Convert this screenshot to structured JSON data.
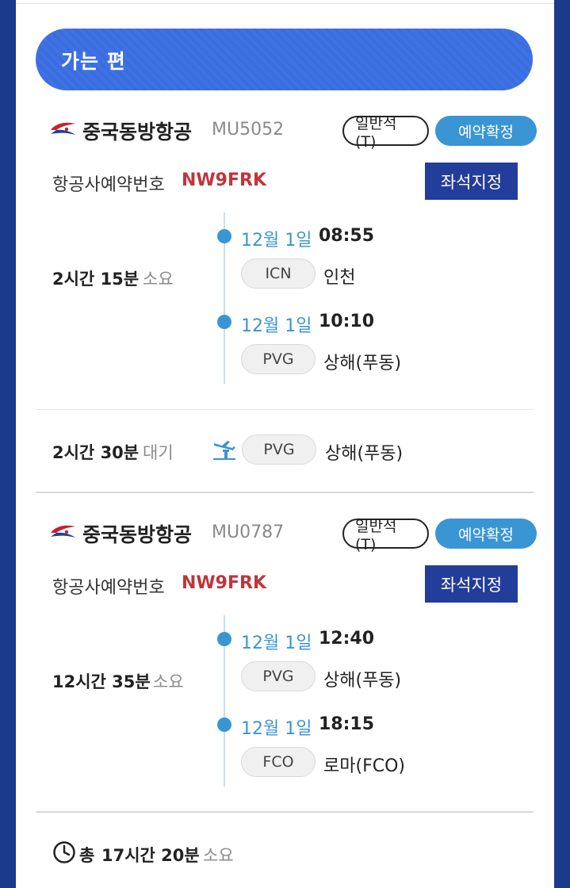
{
  "header": {
    "title": "가는 편"
  },
  "segments": [
    {
      "airline": "중국동방항공",
      "flight_no": "MU5052",
      "cabin_class": "일반석(T)",
      "status": "예약확정",
      "pnr_label": "항공사예약번호",
      "pnr_code": "NW9FRK",
      "seat_button": "좌석지정",
      "duration_value": "2시간 15분",
      "duration_suffix": "소요",
      "depart": {
        "date": "12월 1일",
        "time": "08:55",
        "code": "ICN",
        "city": "인천"
      },
      "arrive": {
        "date": "12월 1일",
        "time": "10:10",
        "code": "PVG",
        "city": "상해(푸동)"
      }
    },
    {
      "airline": "중국동방항공",
      "flight_no": "MU0787",
      "cabin_class": "일반석(T)",
      "status": "예약확정",
      "pnr_label": "항공사예약번호",
      "pnr_code": "NW9FRK",
      "seat_button": "좌석지정",
      "duration_value": "12시간 35분",
      "duration_suffix": "소요",
      "depart": {
        "date": "12월 1일",
        "time": "12:40",
        "code": "PVG",
        "city": "상해(푸동)"
      },
      "arrive": {
        "date": "12월 1일",
        "time": "18:15",
        "code": "FCO",
        "city": "로마(FCO)"
      }
    }
  ],
  "layover": {
    "duration_value": "2시간 30분",
    "duration_suffix": "대기",
    "icon": "transfer-icon",
    "code": "PVG",
    "city": "상해(푸동)"
  },
  "total": {
    "icon": "clock-icon",
    "prefix": "총",
    "duration_value": "17시간 20분",
    "duration_suffix": "소요"
  },
  "colors": {
    "background": "#1b3a8c",
    "header_blue": "#3a6ee0",
    "accent_blue": "#3a95d4",
    "seat_button": "#233d9a",
    "pnr_red": "#c0353a"
  }
}
